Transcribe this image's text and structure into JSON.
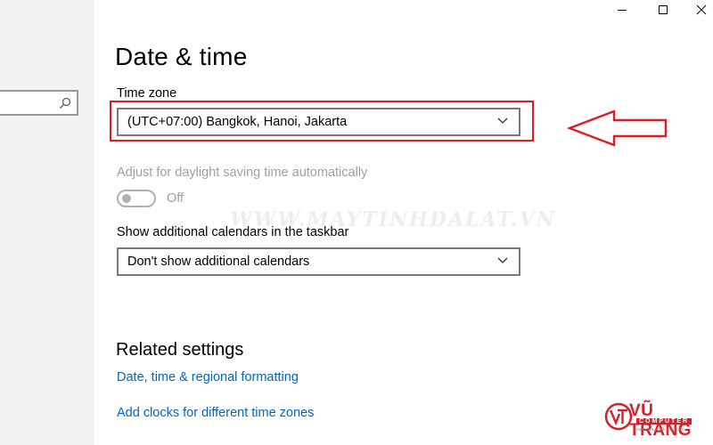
{
  "page": {
    "title": "Date & time",
    "time_zone_label": "Time zone",
    "time_zone_value": "(UTC+07:00) Bangkok, Hanoi, Jakarta",
    "daylight_label": "Adjust for daylight saving time automatically",
    "daylight_toggle_state": "Off",
    "calendars_label": "Show additional calendars in the taskbar",
    "calendars_value": "Don't show additional calendars"
  },
  "related": {
    "title": "Related settings",
    "links": [
      "Date, time & regional formatting",
      "Add clocks for different time zones"
    ]
  },
  "window_controls": [
    "minimize-icon",
    "maximize-icon",
    "close-icon"
  ],
  "search": {
    "icon": "search-icon"
  },
  "overlay": {
    "watermark": "WWW.MAYTINHDALAT.VN",
    "logo_title": "VŨ TRANG",
    "logo_subtitle": "COMPUTER",
    "logo_url": "www.maytinhdalat.vn",
    "highlight_color": "#e01b24"
  },
  "colors": {
    "link": "#0067c0",
    "disabled_text": "#a0a0a0",
    "sidebar_bg": "#f2f2f2"
  }
}
